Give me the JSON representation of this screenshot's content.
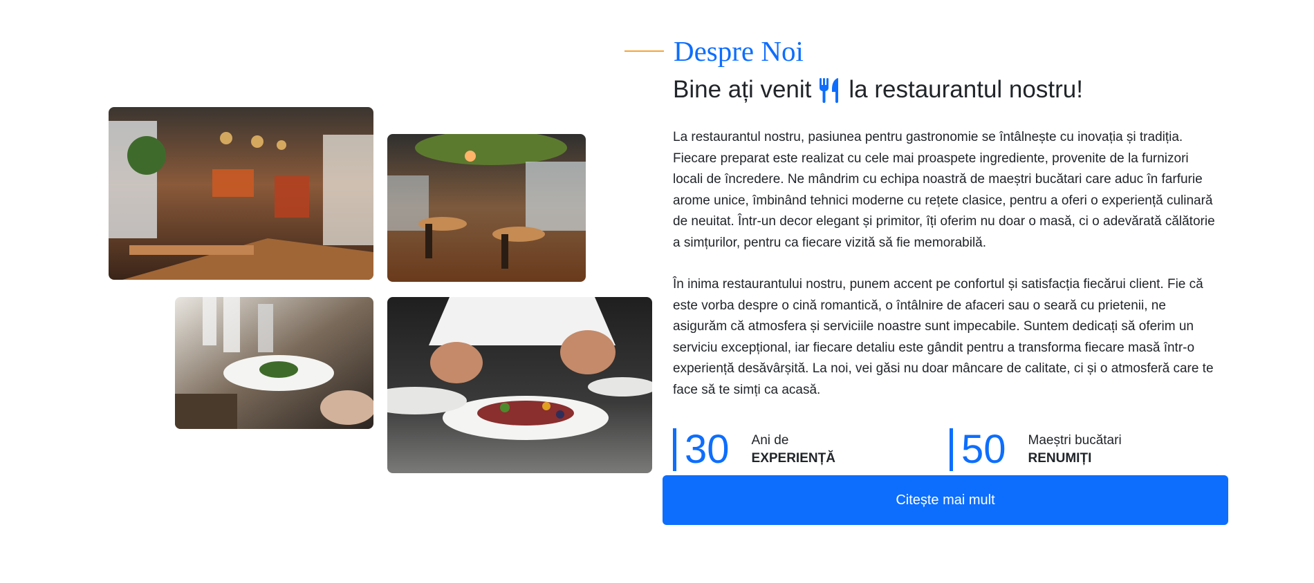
{
  "about": {
    "eyebrow": "Despre Noi",
    "headline_before": "Bine ați venit",
    "headline_icon": "utensils-icon",
    "headline_after": "la restaurantul nostru!",
    "paragraph_1": "La restaurantul nostru, pasiunea pentru gastronomie se întâlnește cu inovația și tradiția. Fiecare preparat este realizat cu cele mai proaspete ingrediente, provenite de la furnizori locali de încredere. Ne mândrim cu echipa noastră de maeștri bucătari care aduc în farfurie arome unice, îmbinând tehnici moderne cu rețete clasice, pentru a oferi o experiență culinară de neuitat. Într-un decor elegant și primitor, îți oferim nu doar o masă, ci o adevărată călătorie a simțurilor, pentru ca fiecare vizită să fie memorabilă.",
    "paragraph_2": "În inima restaurantului nostru, punem accent pe confortul și satisfacția fiecărui client. Fie că este vorba despre o cină romantică, o întâlnire de afaceri sau o seară cu prietenii, ne asigurăm că atmosfera și serviciile noastre sunt impecabile. Suntem dedicați să oferim un serviciu excepțional, iar fiecare detaliu este gândit pentru a transforma fiecare masă într-o experiență desăvârșită. La noi, vei găsi nu doar mâncare de calitate, ci și o atmosferă care te face să te simți ca acasă.",
    "stats": [
      {
        "number": "30",
        "label": "Ani de",
        "strong": "EXPERIENȚĂ"
      },
      {
        "number": "50",
        "label": "Maeștri bucătari",
        "strong": "RENUMIȚI"
      }
    ],
    "button_label": "Citește mai mult"
  },
  "colors": {
    "accent": "#0d6efd",
    "eyebrow_line": "#f2a43a",
    "text": "#212529"
  },
  "images": [
    "restaurant-interior-photo",
    "restaurant-dining-room-photo",
    "table-setting-photo",
    "chef-plating-photo"
  ]
}
